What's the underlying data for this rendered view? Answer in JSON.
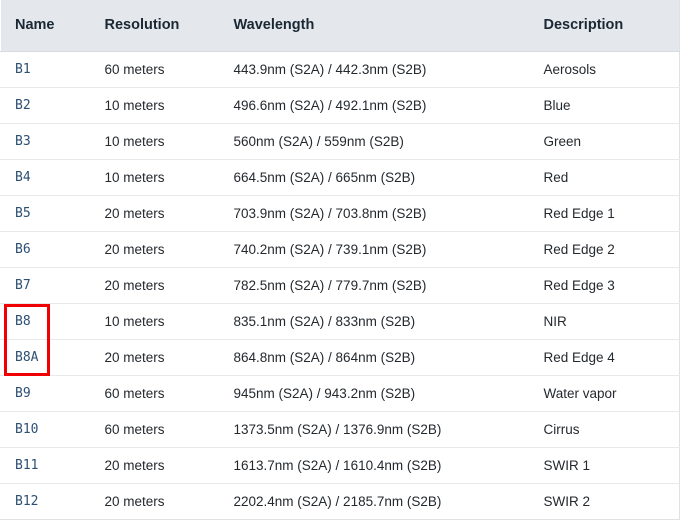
{
  "table": {
    "columns": [
      {
        "key": "name",
        "label": "Name"
      },
      {
        "key": "resolution",
        "label": "Resolution"
      },
      {
        "key": "wavelength",
        "label": "Wavelength"
      },
      {
        "key": "description",
        "label": "Description"
      }
    ],
    "rows": [
      {
        "name": "B1",
        "resolution": "60 meters",
        "wavelength": "443.9nm (S2A) / 442.3nm (S2B)",
        "description": "Aerosols"
      },
      {
        "name": "B2",
        "resolution": "10 meters",
        "wavelength": "496.6nm (S2A) / 492.1nm (S2B)",
        "description": "Blue"
      },
      {
        "name": "B3",
        "resolution": "10 meters",
        "wavelength": "560nm (S2A) / 559nm (S2B)",
        "description": "Green"
      },
      {
        "name": "B4",
        "resolution": "10 meters",
        "wavelength": "664.5nm (S2A) / 665nm (S2B)",
        "description": "Red"
      },
      {
        "name": "B5",
        "resolution": "20 meters",
        "wavelength": "703.9nm (S2A) / 703.8nm (S2B)",
        "description": "Red Edge 1"
      },
      {
        "name": "B6",
        "resolution": "20 meters",
        "wavelength": "740.2nm (S2A) / 739.1nm (S2B)",
        "description": "Red Edge 2"
      },
      {
        "name": "B7",
        "resolution": "20 meters",
        "wavelength": "782.5nm (S2A) / 779.7nm (S2B)",
        "description": "Red Edge 3"
      },
      {
        "name": "B8",
        "resolution": "10 meters",
        "wavelength": "835.1nm (S2A) / 833nm (S2B)",
        "description": "NIR"
      },
      {
        "name": "B8A",
        "resolution": "20 meters",
        "wavelength": "864.8nm (S2A) / 864nm (S2B)",
        "description": "Red Edge 4"
      },
      {
        "name": "B9",
        "resolution": "60 meters",
        "wavelength": "945nm (S2A) / 943.2nm (S2B)",
        "description": "Water vapor"
      },
      {
        "name": "B10",
        "resolution": "60 meters",
        "wavelength": "1373.5nm (S2A) / 1376.9nm (S2B)",
        "description": "Cirrus"
      },
      {
        "name": "B11",
        "resolution": "20 meters",
        "wavelength": "1613.7nm (S2A) / 1610.4nm (S2B)",
        "description": "SWIR 1"
      },
      {
        "name": "B12",
        "resolution": "20 meters",
        "wavelength": "2202.4nm (S2A) / 2185.7nm (S2B)",
        "description": "SWIR 2"
      }
    ]
  },
  "annotation": {
    "color": "#f00000",
    "target_rows": [
      "B8",
      "B8A"
    ]
  },
  "colors": {
    "header_background": "#e4e8ec",
    "header_text": "#1b2733",
    "body_text": "#24292e",
    "name_text": "#2d4f73",
    "row_border": "#e7eaed",
    "annotation": "#f00000"
  }
}
